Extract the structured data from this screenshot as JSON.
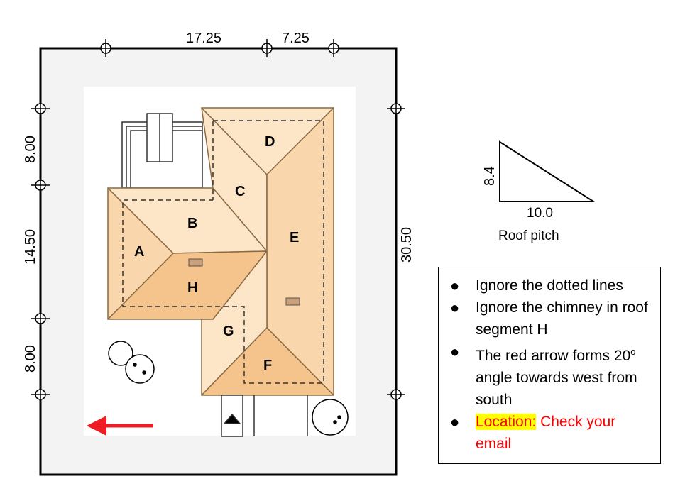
{
  "dimensions": {
    "top_left": "17.25",
    "top_right": "7.25",
    "left_top": "8.00",
    "left_mid": "14.50",
    "left_bottom": "8.00",
    "right": "30.50"
  },
  "segments": [
    "A",
    "B",
    "C",
    "D",
    "E",
    "F",
    "G",
    "H"
  ],
  "pitch": {
    "rise": "8.4",
    "run": "10.0",
    "caption": "Roof pitch"
  },
  "notes": {
    "item1": "Ignore the dotted lines",
    "item2": "Ignore the chimney in roof segment H",
    "item3_pre": "The red arrow forms 20",
    "item3_sup": "o",
    "item3_post": " angle towards west from south",
    "item4_label": "Location:",
    "item4_text": " Check your email"
  },
  "colors": {
    "roof_light": "#fde5c7",
    "roof_mid": "#f9d6ab",
    "roof_dark": "#f5c48d",
    "arrow": "#ee1c24",
    "lot": "#f3f3f3"
  }
}
